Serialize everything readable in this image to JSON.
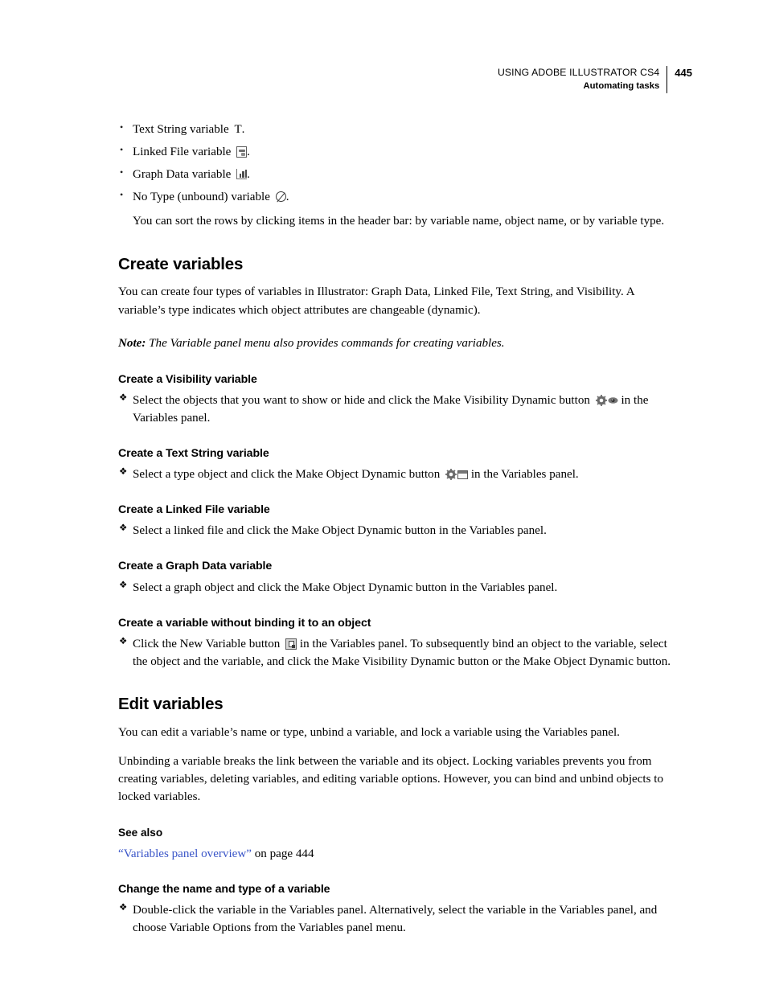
{
  "header": {
    "title": "USING ADOBE ILLUSTRATOR CS4",
    "subtitle": "Automating tasks",
    "page_number": "445"
  },
  "variable_types": {
    "items": [
      {
        "prefix": "Text String variable",
        "icon": "text-string-icon",
        "suffix": "."
      },
      {
        "prefix": "Linked File variable",
        "icon": "linked-file-icon",
        "suffix": "."
      },
      {
        "prefix": "Graph Data variable",
        "icon": "graph-data-icon",
        "suffix": "."
      },
      {
        "prefix": "No Type (unbound) variable",
        "icon": "no-type-icon",
        "suffix": "."
      }
    ],
    "note": "You can sort the rows by clicking items in the header bar: by variable name, object name, or by variable type."
  },
  "create_variables": {
    "heading": "Create variables",
    "intro": "You can create four types of variables in Illustrator: Graph Data, Linked File, Text String, and Visibility. A variable’s type indicates which object attributes are changeable (dynamic).",
    "note_label": "Note:",
    "note_text": "The Variable panel menu also provides commands for creating variables.",
    "subsections": [
      {
        "heading": "Create a Visibility variable",
        "step_before": "Select the objects that you want to show or hide and click the Make Visibility Dynamic button",
        "step_after": "in the Variables panel."
      },
      {
        "heading": "Create a Text String variable",
        "step_before": "Select a type object and click the Make Object Dynamic button",
        "step_after": "in the Variables panel."
      },
      {
        "heading": "Create a Linked File variable",
        "step_full": "Select a linked file and click the Make Object Dynamic button in the Variables panel."
      },
      {
        "heading": "Create a Graph Data variable",
        "step_full": "Select a graph object and click the Make Object Dynamic button in the Variables panel."
      },
      {
        "heading": "Create a variable without binding it to an object",
        "step_before": "Click the New Variable button",
        "step_after": "in the Variables panel. To subsequently bind an object to the variable, select the object and the variable, and click the Make Visibility Dynamic button or the Make Object Dynamic button."
      }
    ]
  },
  "edit_variables": {
    "heading": "Edit variables",
    "para1": "You can edit a variable’s name or type, unbind a variable, and lock a variable using the Variables panel.",
    "para2": "Unbinding a variable breaks the link between the variable and its object. Locking variables prevents you from creating variables, deleting variables, and editing variable options. However, you can bind and unbind objects to locked variables.",
    "see_also": {
      "heading": "See also",
      "open_quote": "“",
      "link_text": "Variables panel overview",
      "close_quote": "”",
      "page_ref": " on page 444",
      "link_color": "#3a55c8"
    },
    "change_name": {
      "heading": "Change the name and type of a variable",
      "step_full": "Double-click the variable in the Variables panel. Alternatively, select the variable in the Variables panel, and choose Variable Options from the Variables panel menu."
    }
  }
}
